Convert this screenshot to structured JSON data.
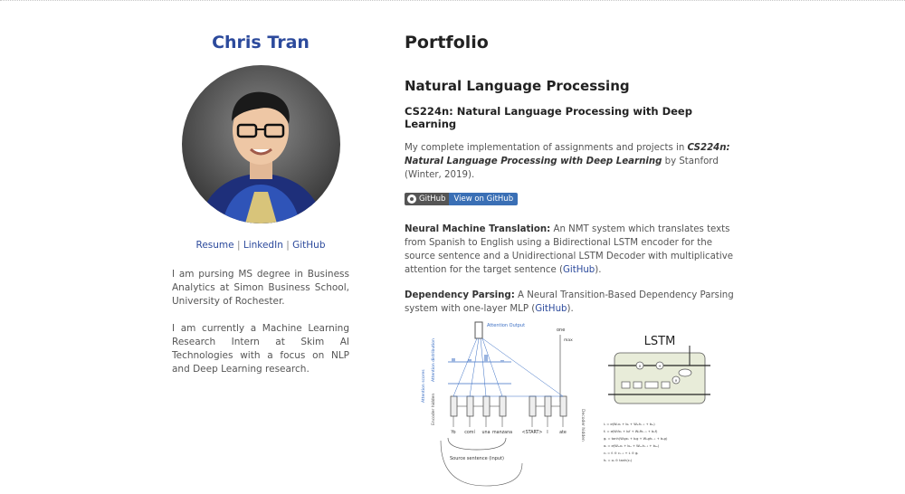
{
  "sidebar": {
    "name": "Chris Tran",
    "links": {
      "resume": "Resume",
      "linkedin": "LinkedIn",
      "github": "GitHub",
      "separator": "|"
    },
    "bio": [
      "I am pursing MS degree in Business Analytics at Simon Business School, University of Rochester.",
      "I am currently a Machine Learning Research Intern at Skim AI Technologies with a focus on NLP and Deep Learning research."
    ]
  },
  "main": {
    "title": "Portfolio",
    "section": "Natural Language Processing",
    "course_title": "CS224n: Natural Language Processing with Deep Learning",
    "intro": {
      "prefix": "My complete implementation of assignments and projects in ",
      "course_italic": "CS224n: Natural Language Processing with Deep Learning",
      "suffix": " by Stanford (Winter, 2019)."
    },
    "badge": {
      "left": "GitHub",
      "right": "View on GitHub"
    },
    "nmt": {
      "label": "Neural Machine Translation:",
      "text": " An NMT system which translates texts from Spanish to English using a Bidirectional LSTM encoder for the source sentence and a Unidirectional LSTM Decoder with multiplicative attention for the target sentence (",
      "link": "GitHub",
      "end": ")."
    },
    "dep": {
      "label": "Dependency Parsing:",
      "text": " A Neural Transition-Based Dependency Parsing system with one-layer MLP (",
      "link": "GitHub",
      "end": ")."
    }
  },
  "figures": {
    "nmt": {
      "attention_output": "Attention Output",
      "attention_distribution": "Attention distribution",
      "attention_scores": "Attention scores",
      "encoder_hidden": "Encoder hidden",
      "decoder_hidden": "Decoder hidden",
      "words": [
        "Yo",
        "comí",
        "una",
        "manzana",
        "<START>",
        "I",
        "ate"
      ],
      "top_word": "one",
      "softmax": "max",
      "source_caption": "Source sentence (input)"
    },
    "lstm": {
      "title": "LSTM",
      "equations": [
        "iₜ = σ(Wᵢᵢxₜ + bᵢᵢ + Wₕᵢhₜ₋₁ + bₕᵢ)",
        "fₜ = σ(Wᵢfxₜ + bᵢf + Wₕfhₜ₋₁ + bₕf)",
        "gₜ = tanh(Wᵢgxₜ + bᵢg + Wₕghₜ₋₁ + bₕg)",
        "oₜ = σ(Wᵢₒxₜ + bᵢₒ + Wₕₒhₜ₋₁ + bₕₒ)",
        "cₜ = fₜ ⊙ cₜ₋₁ + iₜ ⊙ gₜ",
        "hₜ = oₜ ⊙ tanh(cₜ)"
      ]
    }
  },
  "colors": {
    "name": "#2c4a9c",
    "link": "#2c4a9c",
    "badge_right": "#3a6fb5",
    "badge_left": "#555555"
  },
  "icons": {
    "avatar": "portrait-photo",
    "github_badge": "github-icon"
  }
}
